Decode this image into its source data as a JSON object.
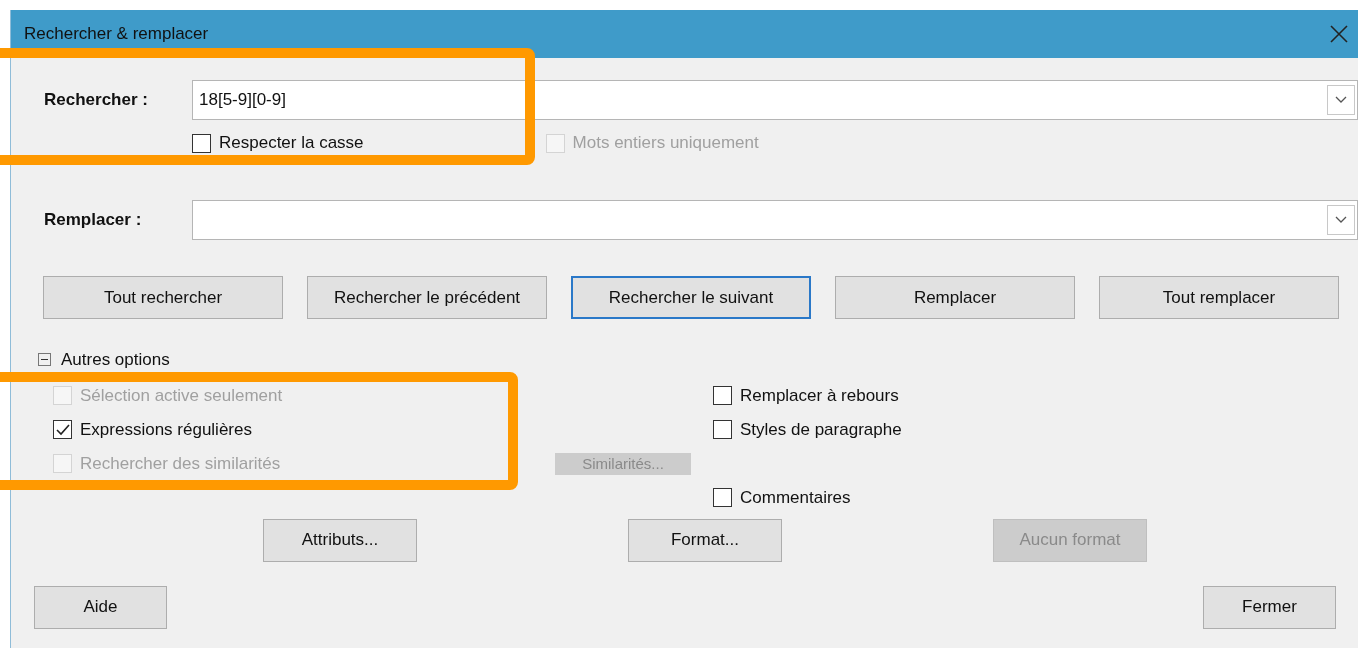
{
  "window": {
    "title": "Rechercher & remplacer"
  },
  "search": {
    "label": "Rechercher :",
    "value": "18[5-9][0-9]"
  },
  "search_options": [
    {
      "label": "Respecter la casse",
      "checked": false,
      "disabled": false
    },
    {
      "label": "Mots entiers uniquement",
      "checked": false,
      "disabled": true
    }
  ],
  "replace": {
    "label": "Remplacer :"
  },
  "action_buttons": [
    {
      "label": "Tout rechercher",
      "focused": false
    },
    {
      "label": "Rechercher le précédent",
      "focused": false
    },
    {
      "label": "Rechercher le suivant",
      "focused": true
    },
    {
      "label": "Remplacer",
      "focused": false
    },
    {
      "label": "Tout remplacer",
      "focused": false
    }
  ],
  "more_options": {
    "label": "Autres options",
    "expanded": true
  },
  "left_options": [
    {
      "label": "Sélection active seulement",
      "checked": false,
      "disabled": true
    },
    {
      "label": "Expressions régulières",
      "checked": true,
      "disabled": false
    },
    {
      "label": "Rechercher des similarités",
      "checked": false,
      "disabled": true
    }
  ],
  "similarities_button": {
    "label": "Similarités...",
    "disabled": true
  },
  "right_options": [
    {
      "label": "Remplacer à rebours",
      "checked": false,
      "disabled": false
    },
    {
      "label": "Styles de paragraphe",
      "checked": false,
      "disabled": false
    },
    {
      "label": "Commentaires",
      "checked": false,
      "disabled": false
    }
  ],
  "format_buttons": [
    {
      "label": "Attributs...",
      "disabled": false
    },
    {
      "label": "Format...",
      "disabled": false
    },
    {
      "label": "Aucun format",
      "disabled": true
    }
  ],
  "footer_buttons": [
    {
      "label": "Aide"
    },
    {
      "label": "Fermer"
    }
  ]
}
